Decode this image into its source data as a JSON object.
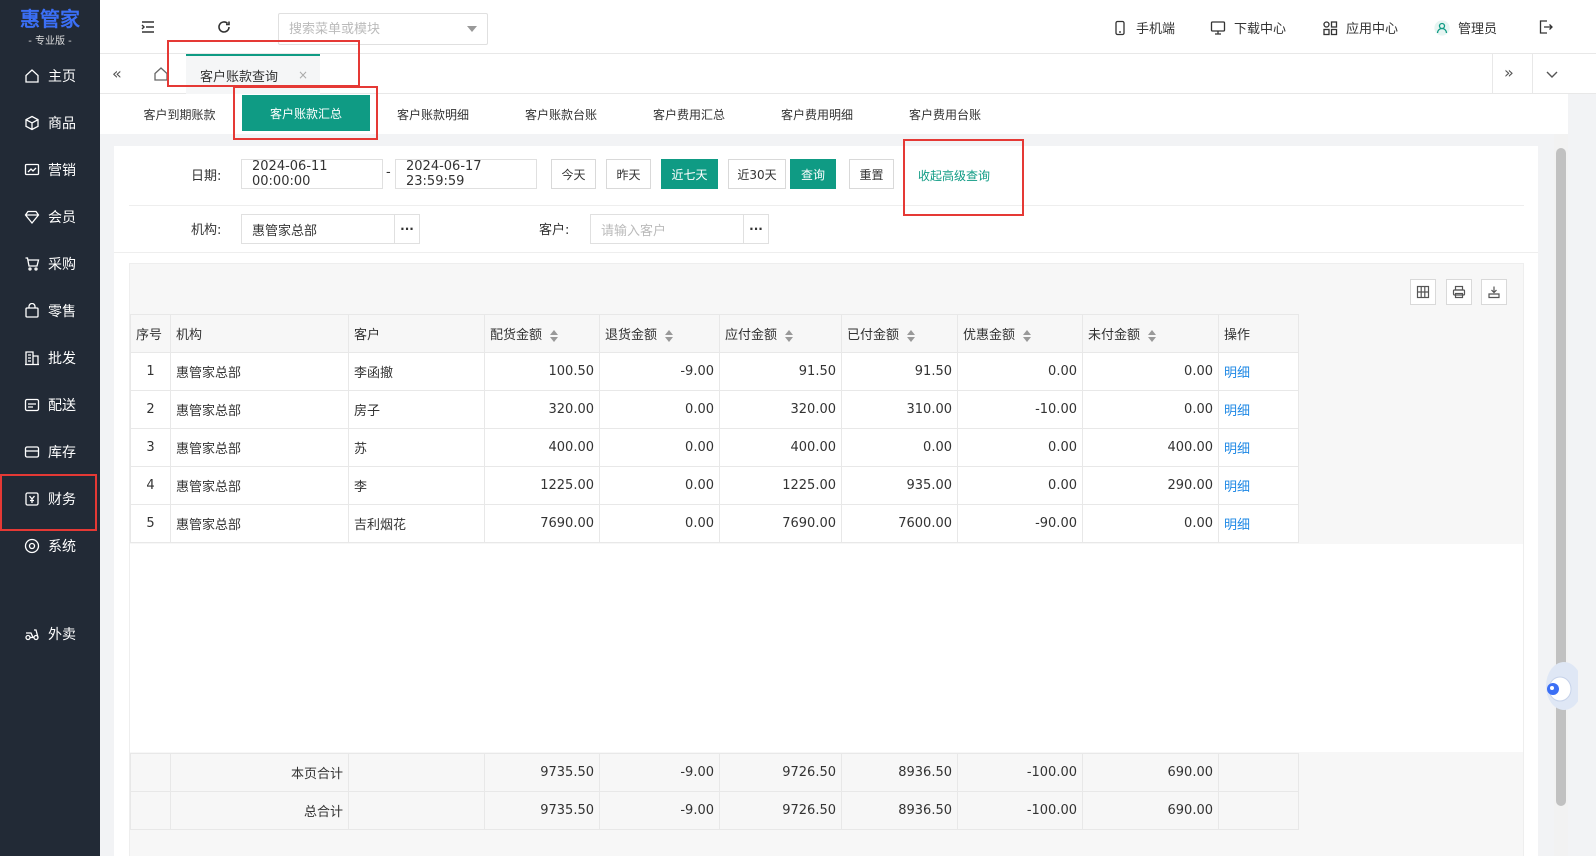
{
  "sidebar": {
    "logo_main": "惠管家",
    "logo_sub": "- 专业版 -",
    "items": [
      {
        "label": "主页",
        "icon": "home-icon"
      },
      {
        "label": "商品",
        "icon": "cube-icon"
      },
      {
        "label": "营销",
        "icon": "chart-icon"
      },
      {
        "label": "会员",
        "icon": "diamond-icon"
      },
      {
        "label": "采购",
        "icon": "cart-icon"
      },
      {
        "label": "零售",
        "icon": "bag-icon"
      },
      {
        "label": "批发",
        "icon": "building-icon"
      },
      {
        "label": "配送",
        "icon": "truck-icon"
      },
      {
        "label": "库存",
        "icon": "box-icon"
      },
      {
        "label": "财务",
        "icon": "yuan-icon"
      },
      {
        "label": "系统",
        "icon": "settings-icon"
      },
      {
        "label": "外卖",
        "icon": "takeout-icon"
      }
    ]
  },
  "topbar": {
    "search_placeholder": "搜索菜单或模块",
    "mobile": "手机端",
    "download": "下载中心",
    "apps": "应用中心",
    "user": "管理员"
  },
  "tabs": {
    "active_label": "客户账款查询",
    "close": "×"
  },
  "subtabs": [
    "客户到期账款",
    "客户账款汇总",
    "客户账款明细",
    "客户账款台账",
    "客户费用汇总",
    "客户费用明细",
    "客户费用台账"
  ],
  "filters": {
    "date_label": "日期:",
    "date_start": "2024-06-11 00:00:00",
    "date_sep": "-",
    "date_end": "2024-06-17 23:59:59",
    "today": "今天",
    "yesterday": "昨天",
    "last7": "近七天",
    "last30": "近30天",
    "query": "查询",
    "reset": "重置",
    "toggle_advanced": "收起高级查询",
    "org_label": "机构:",
    "org_value": "惠管家总部",
    "customer_label": "客户:",
    "customer_placeholder": "请输入客户",
    "dots": "···"
  },
  "table": {
    "headers": [
      "序号",
      "机构",
      "客户",
      "配货金额",
      "退货金额",
      "应付金额",
      "已付金额",
      "优惠金额",
      "未付金额",
      "操作"
    ],
    "rows": [
      [
        "1",
        "惠管家总部",
        "李函撤",
        "100.50",
        "-9.00",
        "91.50",
        "91.50",
        "0.00",
        "0.00",
        "明细"
      ],
      [
        "2",
        "惠管家总部",
        "房子",
        "320.00",
        "0.00",
        "320.00",
        "310.00",
        "-10.00",
        "0.00",
        "明细"
      ],
      [
        "3",
        "惠管家总部",
        "苏",
        "400.00",
        "0.00",
        "400.00",
        "0.00",
        "0.00",
        "400.00",
        "明细"
      ],
      [
        "4",
        "惠管家总部",
        "李",
        "1225.00",
        "0.00",
        "1225.00",
        "935.00",
        "0.00",
        "290.00",
        "明细"
      ],
      [
        "5",
        "惠管家总部",
        "吉利烟花",
        "7690.00",
        "0.00",
        "7690.00",
        "7600.00",
        "-90.00",
        "0.00",
        "明细"
      ]
    ],
    "page_total": {
      "label": "本页合计",
      "values": [
        "9735.50",
        "-9.00",
        "9726.50",
        "8936.50",
        "-100.00",
        "690.00"
      ]
    },
    "grand_total": {
      "label": "总合计",
      "values": [
        "9735.50",
        "-9.00",
        "9726.50",
        "8936.50",
        "-100.00",
        "690.00"
      ]
    }
  },
  "colors": {
    "primary": "#0f9b84",
    "sidebar": "#222a36",
    "highlight": "#e53935",
    "link": "#1e88e5"
  }
}
